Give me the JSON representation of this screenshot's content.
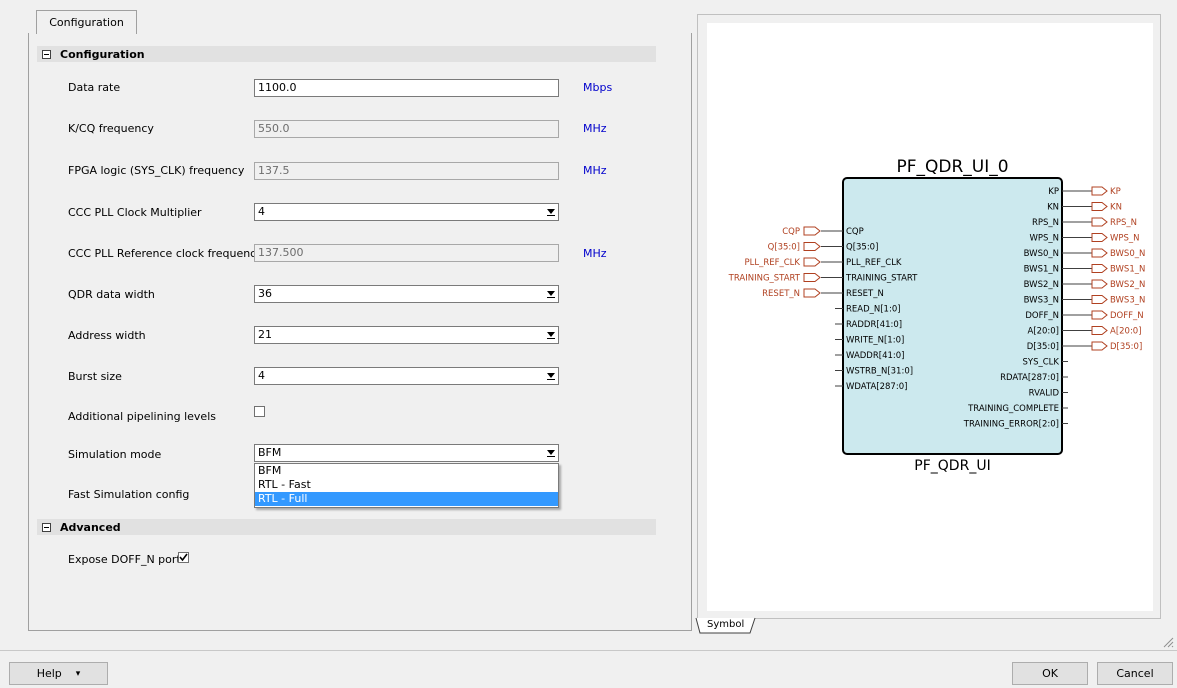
{
  "tabs": {
    "configuration_tab": "Configuration",
    "symbol_tab": "Symbol"
  },
  "sections": {
    "configuration": "Configuration",
    "advanced": "Advanced"
  },
  "fields": {
    "data_rate": {
      "label": "Data rate",
      "value": "1100.0",
      "unit": "Mbps"
    },
    "kcq_freq": {
      "label": "K/CQ frequency",
      "value": "550.0",
      "unit": "MHz"
    },
    "fpga_freq": {
      "label": "FPGA logic (SYS_CLK) frequency",
      "value": "137.5",
      "unit": "MHz"
    },
    "pll_mult": {
      "label": "CCC PLL Clock Multiplier",
      "value": "4"
    },
    "pll_ref": {
      "label": "CCC PLL Reference clock frequency",
      "value": "137.500",
      "unit": "MHz"
    },
    "qdr_width": {
      "label": "QDR data width",
      "value": "36"
    },
    "addr_width": {
      "label": "Address width",
      "value": "21"
    },
    "burst": {
      "label": "Burst size",
      "value": "4"
    },
    "pipeline": {
      "label": "Additional pipelining levels",
      "checked": false
    },
    "sim_mode": {
      "label": "Simulation mode",
      "value": "BFM",
      "options": [
        "BFM",
        "RTL - Fast",
        "RTL - Full"
      ],
      "highlighted": "RTL - Full"
    },
    "fast_sim": {
      "label": "Fast Simulation config"
    },
    "expose_doff": {
      "label": "Expose DOFF_N port",
      "checked": true
    }
  },
  "symbol": {
    "instance_name": "PF_QDR_UI_0",
    "component_name": "PF_QDR_UI",
    "left_ports_ext": [
      "CQP",
      "Q[35:0]",
      "PLL_REF_CLK",
      "TRAINING_START",
      "RESET_N"
    ],
    "left_ports": [
      "CQP",
      "Q[35:0]",
      "PLL_REF_CLK",
      "TRAINING_START",
      "RESET_N",
      "READ_N[1:0]",
      "RADDR[41:0]",
      "WRITE_N[1:0]",
      "WADDR[41:0]",
      "WSTRB_N[31:0]",
      "WDATA[287:0]"
    ],
    "right_ports": [
      "KP",
      "KN",
      "RPS_N",
      "WPS_N",
      "BWS0_N",
      "BWS1_N",
      "BWS2_N",
      "BWS3_N",
      "DOFF_N",
      "A[20:0]",
      "D[35:0]",
      "SYS_CLK",
      "RDATA[287:0]",
      "RVALID",
      "TRAINING_COMPLETE",
      "TRAINING_ERROR[2:0]"
    ],
    "right_ports_ext": [
      "KP",
      "KN",
      "RPS_N",
      "WPS_N",
      "BWS0_N",
      "BWS1_N",
      "BWS2_N",
      "BWS3_N",
      "DOFF_N",
      "A[20:0]",
      "D[35:0]"
    ],
    "colors": {
      "body_fill": "#cce9ee",
      "port_ext": "#b04020",
      "wire": "#404040"
    }
  },
  "buttons": {
    "help": "Help",
    "ok": "OK",
    "cancel": "Cancel"
  }
}
